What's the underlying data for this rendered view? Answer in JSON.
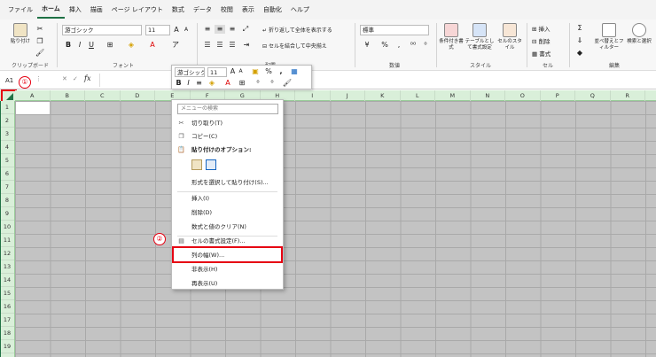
{
  "menu_tabs": [
    "ファイル",
    "ホーム",
    "挿入",
    "描画",
    "ページ レイアウト",
    "数式",
    "データ",
    "校閲",
    "表示",
    "自動化",
    "ヘルプ"
  ],
  "active_tab": "ホーム",
  "ribbon": {
    "paste_label": "貼り付け",
    "clipboard_label": "クリップボード",
    "font_label": "フォント",
    "font_name": "游ゴシック",
    "font_size": "11",
    "alignment_label": "配置",
    "wrap_text": "折り返して全体を表示する",
    "merge_center": "セルを結合して中央揃え",
    "number_label": "数値",
    "number_format": "標準",
    "cond_format": "条件付き書式",
    "table_format": "テーブルとして書式設定",
    "cell_style": "セルのスタイル",
    "style_label": "スタイル",
    "insert": "挿入",
    "delete": "削除",
    "format": "書式",
    "cells_label": "セル",
    "sort_filter": "並べ替えとフィルター",
    "find_select": "検索と選択",
    "edit_label": "編集"
  },
  "formula_bar": {
    "name_box": "A1",
    "fx": "fx"
  },
  "columns": [
    "A",
    "B",
    "C",
    "D",
    "E",
    "F",
    "G",
    "H",
    "I",
    "J",
    "K",
    "L",
    "M",
    "N",
    "O",
    "P",
    "Q",
    "R"
  ],
  "rows": [
    "1",
    "2",
    "3",
    "4",
    "5",
    "6",
    "7",
    "8",
    "9",
    "10",
    "11",
    "12",
    "13",
    "14",
    "15",
    "16",
    "17",
    "18",
    "19"
  ],
  "mini_toolbar": {
    "font_name": "游ゴシック",
    "font_size": "11"
  },
  "context_menu": {
    "search_placeholder": "メニューの検索",
    "items": [
      "切り取り(T)",
      "コピー(C)",
      "貼り付けのオプション:",
      "形式を選択して貼り付け(S)...",
      "挿入(I)",
      "削除(D)",
      "数式と値のクリア(N)",
      "セルの書式設定(F)...",
      "列の幅(W)...",
      "非表示(H)",
      "再表示(U)"
    ]
  },
  "annotations": {
    "step1": "①",
    "step2": "②"
  },
  "colors": {
    "excel_green": "#217346",
    "highlight_red": "#e60012"
  }
}
